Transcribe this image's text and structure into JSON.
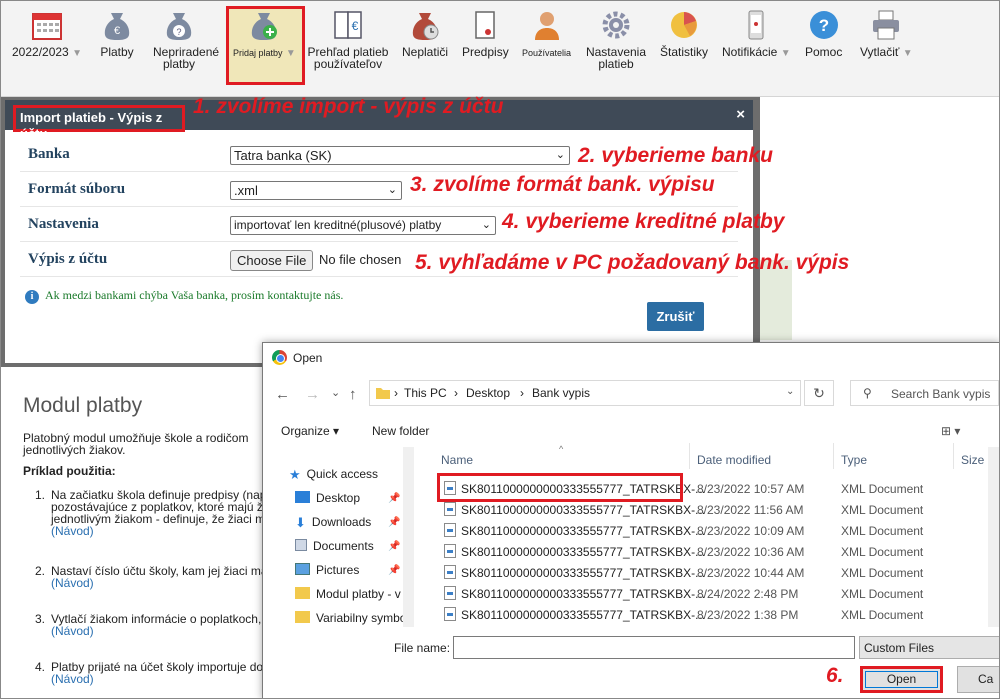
{
  "toolbar": {
    "items": [
      {
        "label": "2022/2023",
        "caret": "▼",
        "icon": "calendar-icon"
      },
      {
        "label": "Platby",
        "icon": "money-bag-euro-icon"
      },
      {
        "label": "Nepriradené platby",
        "icon": "money-bag-question-icon"
      },
      {
        "label": "Pridaj platby",
        "caret": "▼",
        "icon": "money-bag-plus-icon"
      },
      {
        "label": "Prehľad platieb používateľov",
        "icon": "ledger-euro-icon"
      },
      {
        "label": "Neplatiči",
        "icon": "money-bag-clock-icon"
      },
      {
        "label": "Predpisy",
        "icon": "document-icon"
      },
      {
        "label": "Používatelia",
        "icon": "user-icon"
      },
      {
        "label": "Nastavenia platieb",
        "icon": "gear-icon"
      },
      {
        "label": "Štatistiky",
        "icon": "pie-chart-icon"
      },
      {
        "label": "Notifikácie",
        "caret": "▼",
        "icon": "phone-icon"
      },
      {
        "label": "Pomoc",
        "icon": "help-icon"
      },
      {
        "label": "Vytlačiť",
        "caret": "▼",
        "icon": "printer-icon"
      }
    ]
  },
  "import_dialog": {
    "title": "Import platieb - Výpis z účtu",
    "close": "×",
    "rows": [
      {
        "label": "Banka",
        "value": "Tatra banka (SK)"
      },
      {
        "label": "Formát súboru",
        "value": ".xml"
      },
      {
        "label": "Nastavenia",
        "value": "importovať len kreditné(plusové) platby"
      },
      {
        "label": "Výpis z účtu",
        "button": "Choose File",
        "status": "No file chosen"
      }
    ],
    "info": "Ak medzi bankami chýba Vaša banka, prosím kontaktujte nás.",
    "cancel": "Zrušiť"
  },
  "annotations": {
    "step1": "1. zvolíme import - výpis z účtu",
    "step2": "2. vyberieme banku",
    "step3": "3. zvolíme formát bank. výpisu",
    "step4": "4. vyberieme kreditné platby",
    "step5": "5. vyhľadáme v PC požadovaný bank. výpis",
    "step6": "6."
  },
  "page": {
    "title": "Modul platby",
    "intro": "Platobný modul umožňuje škole a rodičom",
    "intro2": "jednotlivých žiakov.",
    "example_heading": "Príklad použitia:",
    "list": [
      {
        "num": "1.",
        "lines": [
          "Na začiatku škola definuje predpisy (nap",
          "pozostávajúce z poplatkov, ktoré majú ž",
          "jednotlivým žiakom - definuje, že žiaci m"
        ],
        "link": "(Návod)"
      },
      {
        "num": "2.",
        "lines": [
          "Nastaví číslo účtu školy, kam jej žiaci ma"
        ],
        "link": "(Návod)"
      },
      {
        "num": "3.",
        "lines": [
          "Vytlačí žiakom informácie o poplatkoch,"
        ],
        "link": "(Návod)"
      },
      {
        "num": "4.",
        "lines": [
          "Platby prijaté na účet školy importuje do"
        ],
        "link": "(Návod)"
      }
    ]
  },
  "open_dialog": {
    "title": "Open",
    "back": "←",
    "forward": "→",
    "recent": "⌄",
    "up": "↑",
    "breadcrumb": [
      "This PC",
      "Desktop",
      "Bank vypis"
    ],
    "separator": "›",
    "refresh": "↻",
    "search_placeholder": "Search Bank vypis",
    "organize": "Organize ▾",
    "new_folder": "New folder",
    "view": "⊞ ▾",
    "nav": [
      {
        "label": "Quick access",
        "icon": "star-icon"
      },
      {
        "label": "Desktop",
        "icon": "desktop-icon"
      },
      {
        "label": "Downloads",
        "icon": "download-icon"
      },
      {
        "label": "Documents",
        "icon": "documents-icon"
      },
      {
        "label": "Pictures",
        "icon": "pictures-icon"
      },
      {
        "label": "Modul platby - v",
        "icon": "folder-icon"
      },
      {
        "label": "Variabilny symbo",
        "icon": "folder-icon"
      }
    ],
    "columns": {
      "name": "Name",
      "date": "Date modified",
      "type": "Type",
      "size": "Size"
    },
    "files": [
      {
        "name": "SK8011000000000333555777_TATRSKBX-...",
        "date": "8/23/2022 10:57 AM",
        "type": "XML Document"
      },
      {
        "name": "SK8011000000000333555777_TATRSKBX-...",
        "date": "8/23/2022 11:56 AM",
        "type": "XML Document"
      },
      {
        "name": "SK8011000000000333555777_TATRSKBX-...",
        "date": "8/23/2022 10:09 AM",
        "type": "XML Document"
      },
      {
        "name": "SK8011000000000333555777_TATRSKBX-...",
        "date": "8/23/2022 10:36 AM",
        "type": "XML Document"
      },
      {
        "name": "SK8011000000000333555777_TATRSKBX-...",
        "date": "8/23/2022 10:44 AM",
        "type": "XML Document"
      },
      {
        "name": "SK8011000000000333555777_TATRSKBX-...",
        "date": "8/24/2022 2:48 PM",
        "type": "XML Document"
      },
      {
        "name": "SK8011000000000333555777_TATRSKBX-...",
        "date": "8/23/2022 1:38 PM",
        "type": "XML Document"
      }
    ],
    "file_name_label": "File name:",
    "file_name_value": "",
    "filter": "Custom Files",
    "open": "Open",
    "cancel": "Ca"
  },
  "colors": {
    "annotation": "#e01b22",
    "dialog_header": "#3f4a57",
    "button_blue": "#2b6da3",
    "label_navy": "#23435f"
  }
}
